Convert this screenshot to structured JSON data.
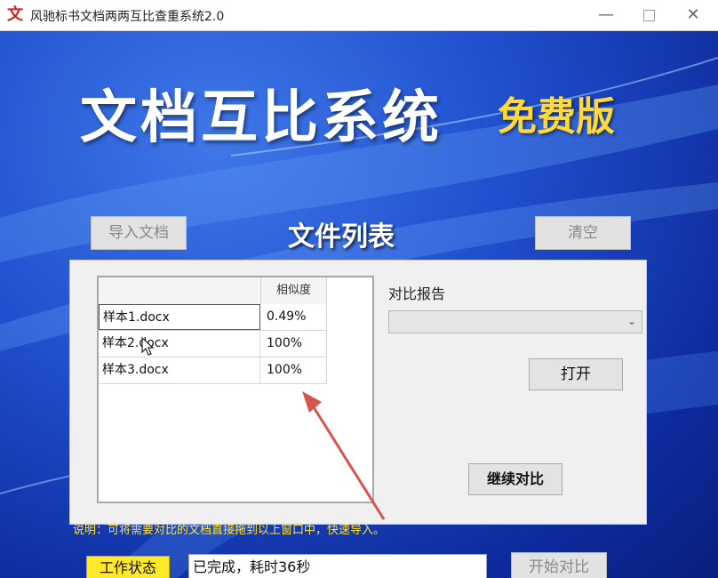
{
  "window": {
    "icon_glyph": "文",
    "title": "风驰标书文档两两互比查重系统2.0",
    "min_glyph": "—",
    "close_glyph": "✕"
  },
  "banner": {
    "title": "文档互比系统",
    "edition": "免费版"
  },
  "toolbar": {
    "import_label": "导入文档",
    "list_title": "文件列表",
    "clear_label": "清空"
  },
  "file_list": {
    "column_header": "相似度",
    "rows": [
      {
        "name": "样本1.docx",
        "similarity": "0.49%"
      },
      {
        "name": "样本2.docx",
        "similarity": "100%"
      },
      {
        "name": "样本3.docx",
        "similarity": "100%"
      }
    ]
  },
  "report": {
    "label": "对比报告",
    "select_value": "",
    "open_label": "打开",
    "continue_label": "继续对比"
  },
  "hint": "说明：可将需要对比的文档直接拖到以上窗口中，快速导入。",
  "status": {
    "label": "工作状态",
    "value": "已完成，耗时36秒",
    "start_label": "开始对比"
  },
  "colors": {
    "accent_yellow": "#ffea2a",
    "banner_blue": "#1537a8",
    "arrow_red": "#d9534f"
  }
}
